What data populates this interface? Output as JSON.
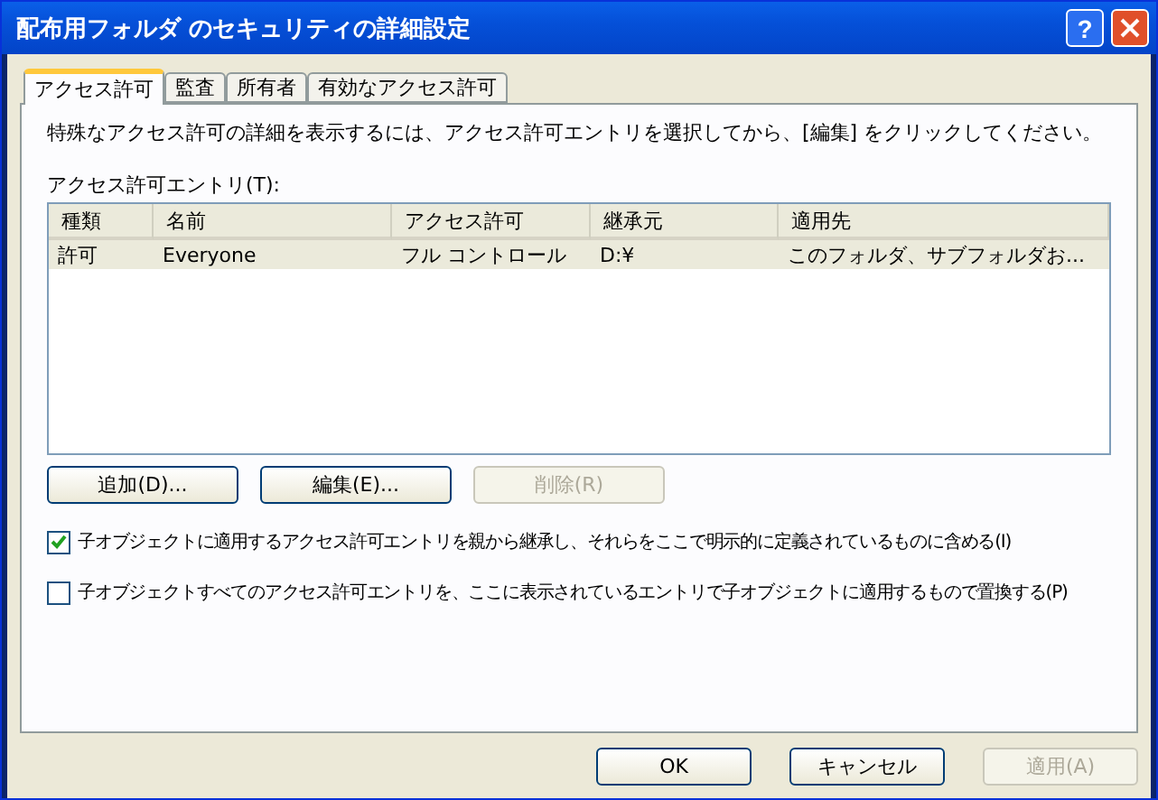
{
  "window": {
    "title": "配布用フォルダ のセキュリティの詳細設定",
    "help_button": "?"
  },
  "tabs": [
    {
      "label": "アクセス許可",
      "selected": true
    },
    {
      "label": "監査",
      "selected": false
    },
    {
      "label": "所有者",
      "selected": false
    },
    {
      "label": "有効なアクセス許可",
      "selected": false
    }
  ],
  "description": "特殊なアクセス許可の詳細を表示するには、アクセス許可エントリを選択してから、[編集] をクリックしてください。",
  "entries_label": "アクセス許可エントリ(T):",
  "table": {
    "columns": [
      "種類",
      "名前",
      "アクセス許可",
      "継承元",
      "適用先"
    ],
    "rows": [
      {
        "cells": [
          "許可",
          "Everyone",
          "フル コントロール",
          "D:¥",
          "このフォルダ、サブフォルダお..."
        ],
        "selected": true
      }
    ]
  },
  "entry_buttons": [
    {
      "label": "追加(D)...",
      "disabled": false
    },
    {
      "label": "編集(E)...",
      "disabled": false
    },
    {
      "label": "削除(R)",
      "disabled": true
    }
  ],
  "checkboxes": [
    {
      "label": "子オブジェクトに適用するアクセス許可エントリを親から継承し、それらをここで明示的に定義されているものに含める(I)",
      "checked": true
    },
    {
      "label": "子オブジェクトすべてのアクセス許可エントリを、ここに表示されているエントリで子オブジェクトに適用するもので置換する(P)",
      "checked": false
    }
  ],
  "dialog_buttons": [
    {
      "label": "OK",
      "disabled": false
    },
    {
      "label": "キャンセル",
      "disabled": false
    },
    {
      "label": "適用(A)",
      "disabled": true
    }
  ]
}
